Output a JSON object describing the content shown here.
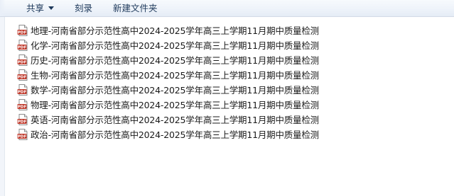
{
  "toolbar": {
    "share_label": "共享",
    "burn_label": "刻录",
    "new_folder_label": "新建文件夹"
  },
  "files": [
    {
      "name": "地理-河南省部分示范性高中2024-2025学年高三上学期11月期中质量检测",
      "icon": "pdf-file-icon"
    },
    {
      "name": "化学-河南省部分示范性高中2024-2025学年高三上学期11月期中质量检测",
      "icon": "pdf-file-icon"
    },
    {
      "name": "历史-河南省部分示范性高中2024-2025学年高三上学期11月期中质量检测",
      "icon": "pdf-file-icon"
    },
    {
      "name": "生物-河南省部分示范性高中2024-2025学年高三上学期11月期中质量检测",
      "icon": "pdf-file-icon"
    },
    {
      "name": "数学-河南省部分示范性高中2024-2025学年高三上学期11月期中质量检测",
      "icon": "pdf-file-icon"
    },
    {
      "name": "物理-河南省部分示范性高中2024-2025学年高三上学期11月期中质量检测",
      "icon": "pdf-file-icon"
    },
    {
      "name": "英语-河南省部分示范性高中2024-2025学年高三上学期11月期中质量检测",
      "icon": "pdf-file-icon"
    },
    {
      "name": "政治-河南省部分示范性高中2024-2025学年高三上学期11月期中质量检测",
      "icon": "pdf-file-icon"
    }
  ],
  "pdf_icon_text": "PDF",
  "colors": {
    "toolbar_text": "#1e395b",
    "pdf_badge": "#c0392b"
  }
}
